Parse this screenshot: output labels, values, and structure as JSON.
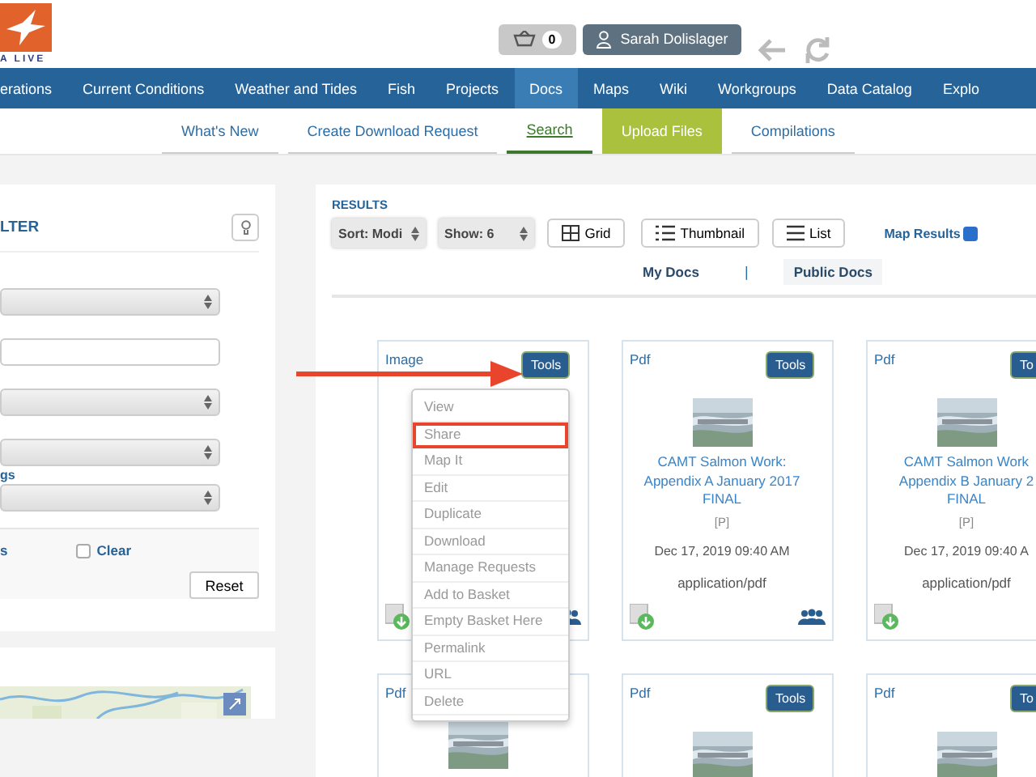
{
  "logo": {
    "text": "A LIVE"
  },
  "header": {
    "basket_count": "0",
    "user": "Sarah Dolislager"
  },
  "nav": [
    {
      "label": "erations",
      "selected": false
    },
    {
      "label": "Current Conditions",
      "selected": false
    },
    {
      "label": "Weather and Tides",
      "selected": false
    },
    {
      "label": "Fish",
      "selected": false
    },
    {
      "label": "Projects",
      "selected": false
    },
    {
      "label": "Docs",
      "selected": true
    },
    {
      "label": "Maps",
      "selected": false
    },
    {
      "label": "Wiki",
      "selected": false
    },
    {
      "label": "Workgroups",
      "selected": false
    },
    {
      "label": "Data Catalog",
      "selected": false
    },
    {
      "label": "Explo",
      "selected": false
    }
  ],
  "subnav": [
    {
      "label": "What's New",
      "kind": "link"
    },
    {
      "label": "Create Download Request",
      "kind": "link"
    },
    {
      "label": "Search",
      "kind": "current"
    },
    {
      "label": "Upload Files",
      "kind": "highlight"
    },
    {
      "label": "Compilations",
      "kind": "link"
    }
  ],
  "filter": {
    "title": "LTER",
    "fields": [
      {
        "kind": "select"
      },
      {
        "kind": "input"
      },
      {
        "kind": "select"
      },
      {
        "kind": "select"
      },
      {
        "kind": "select",
        "label": "gs"
      }
    ],
    "options": [
      {
        "kind": "text",
        "label": "s"
      },
      {
        "kind": "checkbox",
        "label": "Clear",
        "checked": false
      }
    ],
    "reset": "Reset"
  },
  "results": {
    "title": "RESULTS",
    "sort": "Sort: Modi",
    "show": "Show: 6",
    "views": [
      "Grid",
      "Thumbnail",
      "List"
    ],
    "map_results": {
      "label": "Map Results",
      "checked": true
    },
    "tabs": [
      {
        "label": "My Docs",
        "selected": false
      },
      {
        "label": "Public Docs",
        "selected": true
      }
    ],
    "tab_separator": "|",
    "cards": [
      {
        "type": "Image",
        "tools": "Tools",
        "shared": true
      },
      {
        "type": "Pdf",
        "tools": "Tools",
        "title": [
          "CAMT Salmon Work:",
          "Appendix A January 2017",
          "FINAL"
        ],
        "flag": "[P]",
        "date": "Dec 17, 2019 09:40 AM",
        "mime": "application/pdf",
        "shared": true
      },
      {
        "type": "Pdf",
        "tools": "To",
        "title": [
          "CAMT Salmon Work",
          "Appendix B January 2",
          "FINAL"
        ],
        "flag": "[P]",
        "date": "Dec 17, 2019 09:40 A",
        "mime": "application/pdf",
        "shared": false
      },
      {
        "type": "Pdf"
      },
      {
        "type": "Pdf",
        "tools": "Tools"
      },
      {
        "type": "Pdf",
        "tools": "To"
      }
    ],
    "menu": [
      {
        "label": "View",
        "highlighted": false
      },
      {
        "label": "Share",
        "highlighted": true
      },
      {
        "label": "Map It",
        "highlighted": false
      },
      {
        "label": "Edit",
        "highlighted": false
      },
      {
        "label": "Duplicate",
        "highlighted": false
      },
      {
        "label": "Download",
        "highlighted": false
      },
      {
        "label": "Manage Requests",
        "highlighted": false
      },
      {
        "label": "Add to Basket",
        "highlighted": false
      },
      {
        "label": "Empty Basket Here",
        "highlighted": false
      },
      {
        "label": "Permalink",
        "highlighted": false
      },
      {
        "label": "URL",
        "highlighted": false
      },
      {
        "label": "Delete",
        "highlighted": false
      }
    ]
  }
}
